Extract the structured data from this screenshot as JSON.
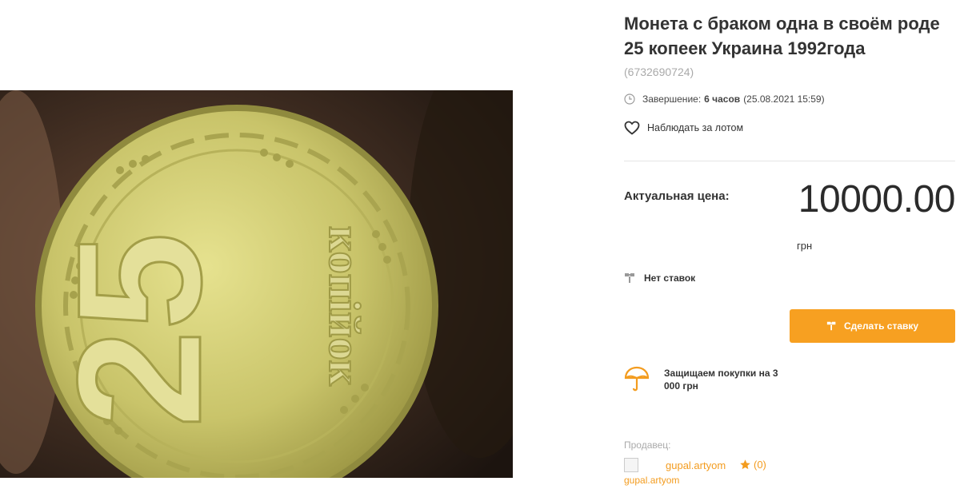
{
  "lot": {
    "title": "Монета с браком одна в своём роде 25 копеек Украина 1992года",
    "id": "(6732690724)",
    "end_label": "Завершение:",
    "end_remaining": "6 часов",
    "end_datetime": "(25.08.2021 15:59)",
    "watch_label": "Наблюдать за лотом"
  },
  "price": {
    "label": "Актуальная цена:",
    "value": "10000.00",
    "currency": "грн"
  },
  "bids": {
    "status": "Нет ставок",
    "button_label": "Сделать ставку"
  },
  "protection": {
    "text": "Защищаем покупки на 3 000 грн"
  },
  "seller": {
    "label": "Продавец:",
    "name": "gupal.artyom",
    "rating": "(0)",
    "image_alt": "gupal.artyom"
  },
  "photo": {
    "coin_numeral": "25",
    "coin_word": "копійок"
  },
  "colors": {
    "accent": "#f7a021",
    "link": "#f39c1f",
    "muted": "#aaaaaa"
  },
  "icons": [
    "clock-icon",
    "heart-icon",
    "gavel-icon",
    "umbrella-icon",
    "star-icon"
  ]
}
